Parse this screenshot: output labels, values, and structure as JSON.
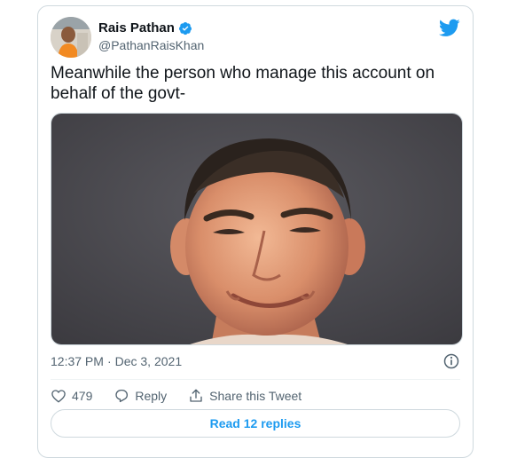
{
  "tweet": {
    "author_name": "Rais Pathan",
    "verified_icon": "verified-badge-icon",
    "handle": "@PathanRaisKhan",
    "text": "Meanwhile the person who manage this account on behalf of the govt-",
    "time": "12:37 PM",
    "separator": "·",
    "date": "Dec 3, 2021",
    "like_count": "479",
    "reply_label": "Reply",
    "share_label": "Share this Tweet",
    "read_replies_label": "Read 12 replies"
  },
  "icons": {
    "brand": "twitter-bird-icon",
    "info": "info-icon",
    "like": "heart-icon",
    "reply": "reply-icon",
    "share": "share-icon"
  },
  "colors": {
    "accent": "#1d9bf0",
    "text": "#0f1419",
    "muted": "#536471",
    "border": "#cfd9de"
  }
}
